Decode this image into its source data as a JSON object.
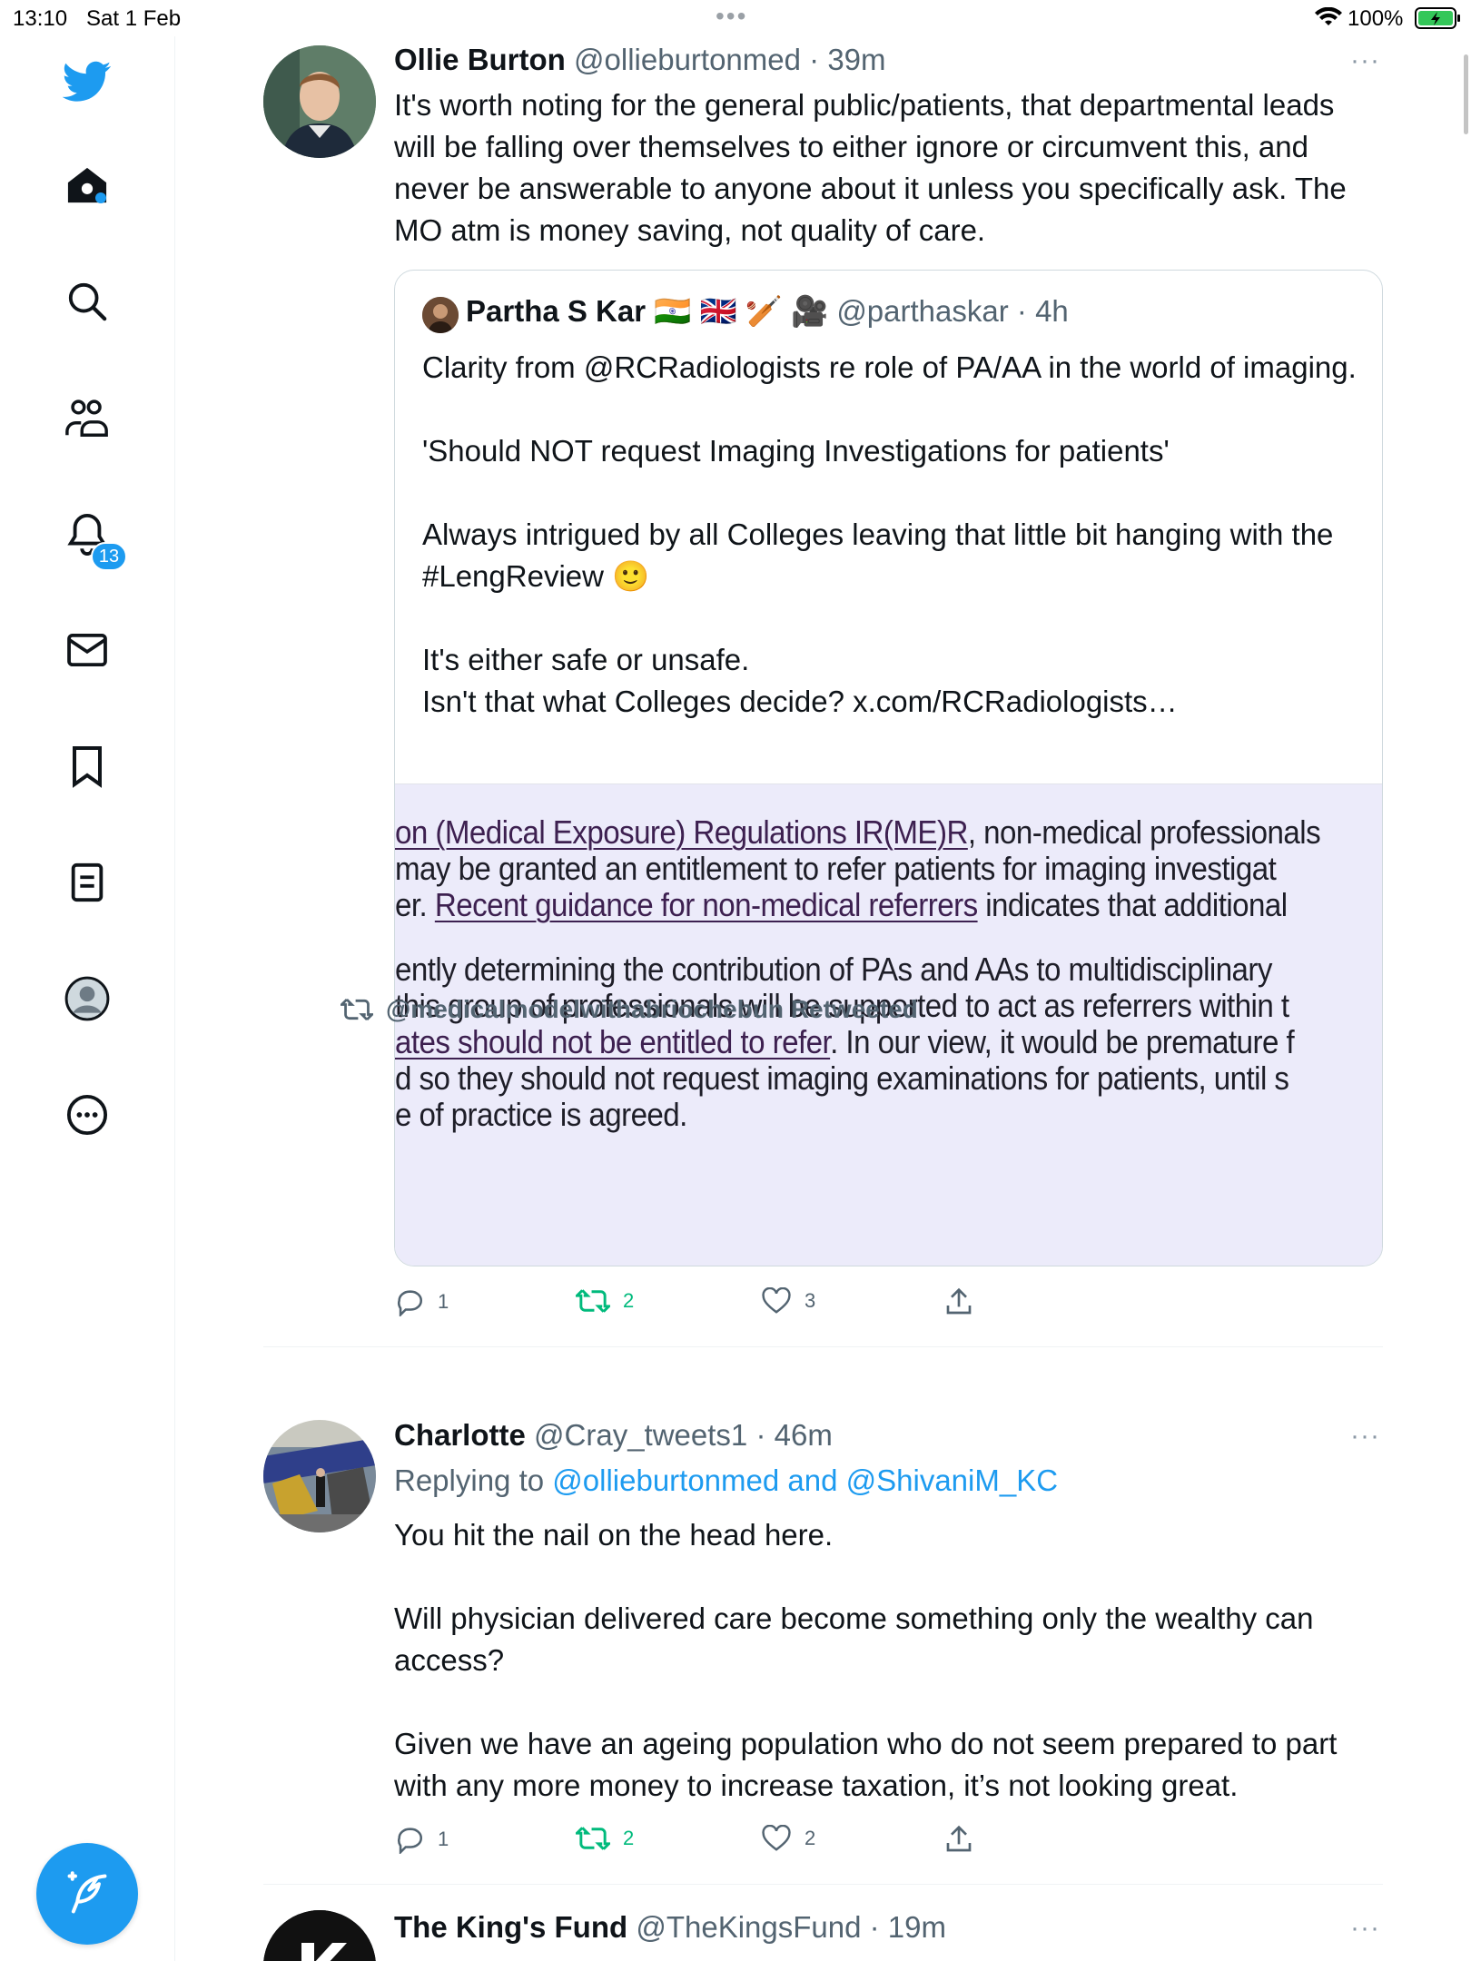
{
  "status_bar": {
    "time": "13:10",
    "date": "Sat 1 Feb",
    "battery": "100%"
  },
  "sidebar": {
    "notifications_badge": "13"
  },
  "tweets": [
    {
      "name": "Ollie Burton",
      "handle": "@ollieburtonmed",
      "time": "· 39m",
      "text": "It's worth noting for the general public/patients, that departmental leads will be falling over themselves to either ignore or circumvent this, and never be answerable to anyone about it unless you specifically ask. The MO atm is money saving, not quality of care.",
      "quote": {
        "name": "Partha S Kar",
        "flags": "🇮🇳 🇬🇧 🏏 🎥",
        "handle": "@parthaskar",
        "time": "· 4h",
        "text": "Clarity from @RCRadiologists re role of PA/AA in the world of imaging.\n\n'Should NOT request Imaging Investigations for patients'\n\nAlways intrigued by all Colleges leaving that little bit hanging with the #LengReview 🙂\n\nIt's either safe or unsafe.\nIsn't that what Colleges decide? x.com/RCRadiologists…",
        "image_lines": [
          {
            "u": "on (Medical Exposure) Regulations IR(ME)R",
            "t": ", non-medical professionals"
          },
          {
            "u": "",
            "t": " may be granted an entitlement to refer patients for imaging investigat"
          },
          {
            "pre": "er. ",
            "u": "Recent guidance for non-medical referrers",
            "t": " indicates that additional"
          },
          {
            "u": "",
            "t": "ently determining the contribution of PAs and AAs to multidisciplinary"
          },
          {
            "u": "",
            "t": "this group of professionals will be supported to act as referrers within t"
          },
          {
            "u": "ates should not be entitled to refer",
            "t": ". In our view, it would be premature f"
          },
          {
            "u": "",
            "t": "d so they should not request imaging examinations for patients, until s"
          },
          {
            "u": "",
            "t": "e of practice is agreed."
          }
        ]
      },
      "replies": "1",
      "retweets": "2",
      "likes": "3"
    },
    {
      "retweeted_by": "@medicalmodelwithabriochebun Retweeted",
      "name": "Charlotte",
      "handle": "@Cray_tweets1",
      "time": "· 46m",
      "replying_prefix": "Replying to ",
      "replying_to": "@ollieburtonmed and @ShivaniM_KC",
      "text": "You hit the nail on the head here.\n\nWill physician delivered care become something only the wealthy can access?\n\nGiven we have an ageing population who do not seem prepared to part with any more money to increase taxation, it’s not looking great.",
      "replies": "1",
      "retweets": "2",
      "likes": "2"
    },
    {
      "name": "The King's Fund",
      "handle": "@TheKingsFund",
      "time": "· 19m"
    }
  ],
  "more_label": "···",
  "colors": {
    "accent": "#1d9bf0",
    "retweet": "#00ba7c",
    "secondary": "#536471"
  }
}
